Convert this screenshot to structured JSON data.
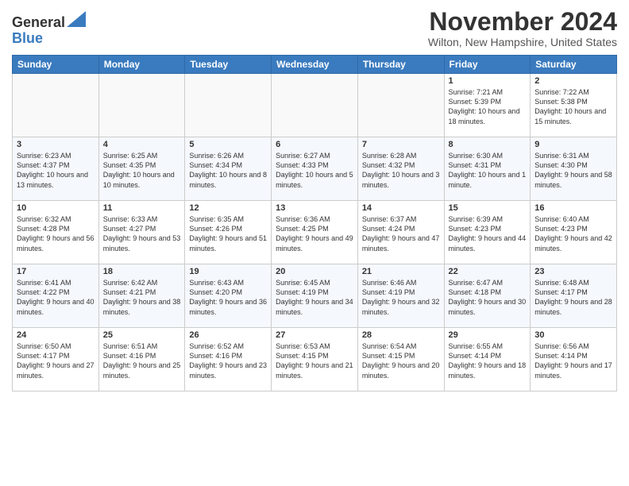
{
  "logo": {
    "general": "General",
    "blue": "Blue"
  },
  "header": {
    "month": "November 2024",
    "location": "Wilton, New Hampshire, United States"
  },
  "weekdays": [
    "Sunday",
    "Monday",
    "Tuesday",
    "Wednesday",
    "Thursday",
    "Friday",
    "Saturday"
  ],
  "weeks": [
    [
      {
        "day": "",
        "text": ""
      },
      {
        "day": "",
        "text": ""
      },
      {
        "day": "",
        "text": ""
      },
      {
        "day": "",
        "text": ""
      },
      {
        "day": "",
        "text": ""
      },
      {
        "day": "1",
        "text": "Sunrise: 7:21 AM\nSunset: 5:39 PM\nDaylight: 10 hours and 18 minutes."
      },
      {
        "day": "2",
        "text": "Sunrise: 7:22 AM\nSunset: 5:38 PM\nDaylight: 10 hours and 15 minutes."
      }
    ],
    [
      {
        "day": "3",
        "text": "Sunrise: 6:23 AM\nSunset: 4:37 PM\nDaylight: 10 hours and 13 minutes."
      },
      {
        "day": "4",
        "text": "Sunrise: 6:25 AM\nSunset: 4:35 PM\nDaylight: 10 hours and 10 minutes."
      },
      {
        "day": "5",
        "text": "Sunrise: 6:26 AM\nSunset: 4:34 PM\nDaylight: 10 hours and 8 minutes."
      },
      {
        "day": "6",
        "text": "Sunrise: 6:27 AM\nSunset: 4:33 PM\nDaylight: 10 hours and 5 minutes."
      },
      {
        "day": "7",
        "text": "Sunrise: 6:28 AM\nSunset: 4:32 PM\nDaylight: 10 hours and 3 minutes."
      },
      {
        "day": "8",
        "text": "Sunrise: 6:30 AM\nSunset: 4:31 PM\nDaylight: 10 hours and 1 minute."
      },
      {
        "day": "9",
        "text": "Sunrise: 6:31 AM\nSunset: 4:30 PM\nDaylight: 9 hours and 58 minutes."
      }
    ],
    [
      {
        "day": "10",
        "text": "Sunrise: 6:32 AM\nSunset: 4:28 PM\nDaylight: 9 hours and 56 minutes."
      },
      {
        "day": "11",
        "text": "Sunrise: 6:33 AM\nSunset: 4:27 PM\nDaylight: 9 hours and 53 minutes."
      },
      {
        "day": "12",
        "text": "Sunrise: 6:35 AM\nSunset: 4:26 PM\nDaylight: 9 hours and 51 minutes."
      },
      {
        "day": "13",
        "text": "Sunrise: 6:36 AM\nSunset: 4:25 PM\nDaylight: 9 hours and 49 minutes."
      },
      {
        "day": "14",
        "text": "Sunrise: 6:37 AM\nSunset: 4:24 PM\nDaylight: 9 hours and 47 minutes."
      },
      {
        "day": "15",
        "text": "Sunrise: 6:39 AM\nSunset: 4:23 PM\nDaylight: 9 hours and 44 minutes."
      },
      {
        "day": "16",
        "text": "Sunrise: 6:40 AM\nSunset: 4:23 PM\nDaylight: 9 hours and 42 minutes."
      }
    ],
    [
      {
        "day": "17",
        "text": "Sunrise: 6:41 AM\nSunset: 4:22 PM\nDaylight: 9 hours and 40 minutes."
      },
      {
        "day": "18",
        "text": "Sunrise: 6:42 AM\nSunset: 4:21 PM\nDaylight: 9 hours and 38 minutes."
      },
      {
        "day": "19",
        "text": "Sunrise: 6:43 AM\nSunset: 4:20 PM\nDaylight: 9 hours and 36 minutes."
      },
      {
        "day": "20",
        "text": "Sunrise: 6:45 AM\nSunset: 4:19 PM\nDaylight: 9 hours and 34 minutes."
      },
      {
        "day": "21",
        "text": "Sunrise: 6:46 AM\nSunset: 4:19 PM\nDaylight: 9 hours and 32 minutes."
      },
      {
        "day": "22",
        "text": "Sunrise: 6:47 AM\nSunset: 4:18 PM\nDaylight: 9 hours and 30 minutes."
      },
      {
        "day": "23",
        "text": "Sunrise: 6:48 AM\nSunset: 4:17 PM\nDaylight: 9 hours and 28 minutes."
      }
    ],
    [
      {
        "day": "24",
        "text": "Sunrise: 6:50 AM\nSunset: 4:17 PM\nDaylight: 9 hours and 27 minutes."
      },
      {
        "day": "25",
        "text": "Sunrise: 6:51 AM\nSunset: 4:16 PM\nDaylight: 9 hours and 25 minutes."
      },
      {
        "day": "26",
        "text": "Sunrise: 6:52 AM\nSunset: 4:16 PM\nDaylight: 9 hours and 23 minutes."
      },
      {
        "day": "27",
        "text": "Sunrise: 6:53 AM\nSunset: 4:15 PM\nDaylight: 9 hours and 21 minutes."
      },
      {
        "day": "28",
        "text": "Sunrise: 6:54 AM\nSunset: 4:15 PM\nDaylight: 9 hours and 20 minutes."
      },
      {
        "day": "29",
        "text": "Sunrise: 6:55 AM\nSunset: 4:14 PM\nDaylight: 9 hours and 18 minutes."
      },
      {
        "day": "30",
        "text": "Sunrise: 6:56 AM\nSunset: 4:14 PM\nDaylight: 9 hours and 17 minutes."
      }
    ]
  ]
}
